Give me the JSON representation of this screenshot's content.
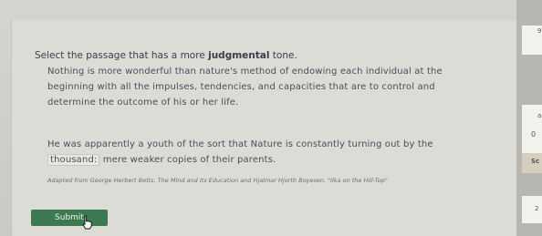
{
  "question": {
    "prompt_before": "Select the passage that has a more ",
    "prompt_emphasis": "judgmental",
    "prompt_after": " tone."
  },
  "passages": [
    {
      "text": "Nothing is more wonderful than nature's method of endowing each individual at the beginning with all the impulses, tendencies, and capacities that are to control and determine the outcome of his or her life."
    },
    {
      "text_before": "He was apparently a youth of the sort that Nature is constantly turning out by the ",
      "highlighted": "thousand:",
      "text_after": " mere weaker copies of their parents."
    }
  ],
  "credit": "Adapted from George Herbert Betts, The Mind and Its Education and Hjalmar Hjorth Boyesen, \"Ilka on the Hill-Top\"",
  "submit_label": "Submit",
  "sidebar_glyphs": [
    "9",
    "a",
    "0",
    "Sc",
    "2"
  ]
}
